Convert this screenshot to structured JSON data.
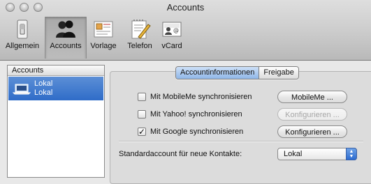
{
  "window": {
    "title": "Accounts"
  },
  "toolbar": {
    "items": [
      {
        "label": "Allgemein",
        "icon": "light-switch-icon"
      },
      {
        "label": "Accounts",
        "icon": "people-icon"
      },
      {
        "label": "Vorlage",
        "icon": "card-template-icon"
      },
      {
        "label": "Telefon",
        "icon": "notepad-pen-icon"
      },
      {
        "label": "vCard",
        "icon": "vcard-icon"
      }
    ],
    "active_index": 1
  },
  "accounts_list": {
    "header": "Accounts",
    "items": [
      {
        "line1": "Lokal",
        "line2": "Lokal",
        "icon": "laptop-icon",
        "selected": true
      }
    ]
  },
  "tabs": {
    "items": [
      "Accountinformationen",
      "Freigabe"
    ],
    "selected_index": 0
  },
  "sync_options": [
    {
      "label": "Mit MobileMe synchronisieren",
      "checked": false,
      "button": "MobileMe ...",
      "button_enabled": true
    },
    {
      "label": "Mit Yahoo! synchronisieren",
      "checked": false,
      "button": "Konfigurieren ...",
      "button_enabled": false
    },
    {
      "label": "Mit Google synchronisieren",
      "checked": true,
      "button": "Konfigurieren ...",
      "button_enabled": true
    }
  ],
  "default_account": {
    "label": "Standardaccount für neue Kontakte:",
    "value": "Lokal"
  },
  "colors": {
    "selection": "#3a74cc",
    "window_bg": "#e8e8e8"
  }
}
